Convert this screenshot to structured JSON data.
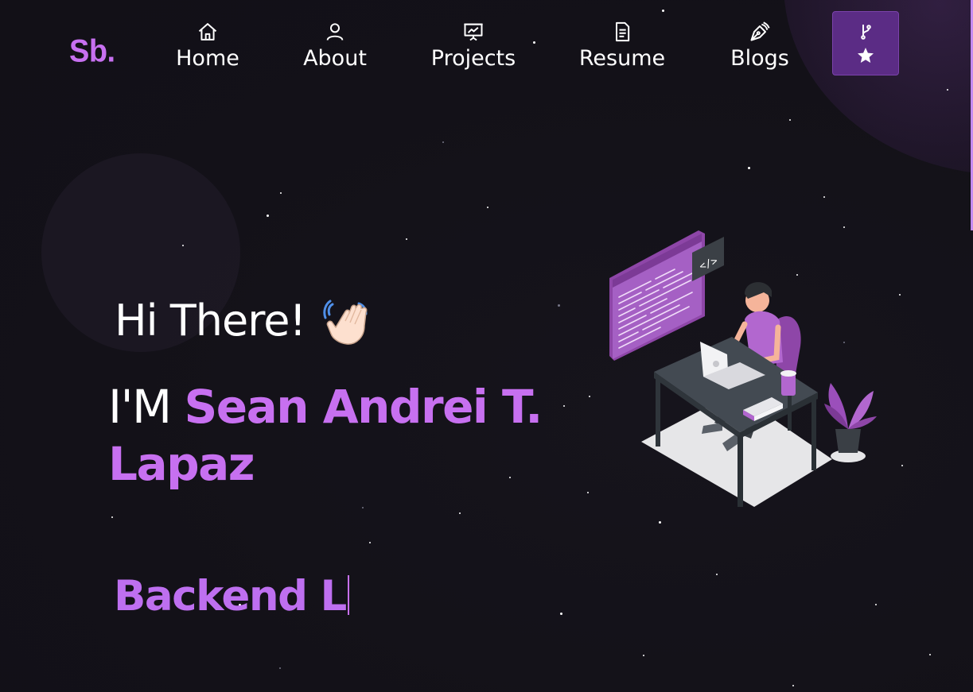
{
  "brand": {
    "logo_text": "Sb.",
    "accent": "#c770f0"
  },
  "nav": {
    "items": [
      {
        "label": "Home",
        "icon": "home-icon"
      },
      {
        "label": "About",
        "icon": "user-icon"
      },
      {
        "label": "Projects",
        "icon": "presentation-icon"
      },
      {
        "label": "Resume",
        "icon": "document-icon"
      },
      {
        "label": "Blogs",
        "icon": "pen-nib-icon"
      }
    ],
    "github_button": {
      "icons": [
        "git-fork-icon",
        "star-icon"
      ],
      "background": "#5b2c85"
    }
  },
  "hero": {
    "greeting": "Hi There!",
    "greeting_emoji": "waving-hand",
    "intro_prefix": "I'M",
    "name": "Sean Andrei T. Lapaz",
    "typed_text": "Backend L",
    "illustration": "developer-at-desk-illustration"
  },
  "colors": {
    "background": "#141219",
    "accent": "#c770f0",
    "text": "#ffffff"
  }
}
